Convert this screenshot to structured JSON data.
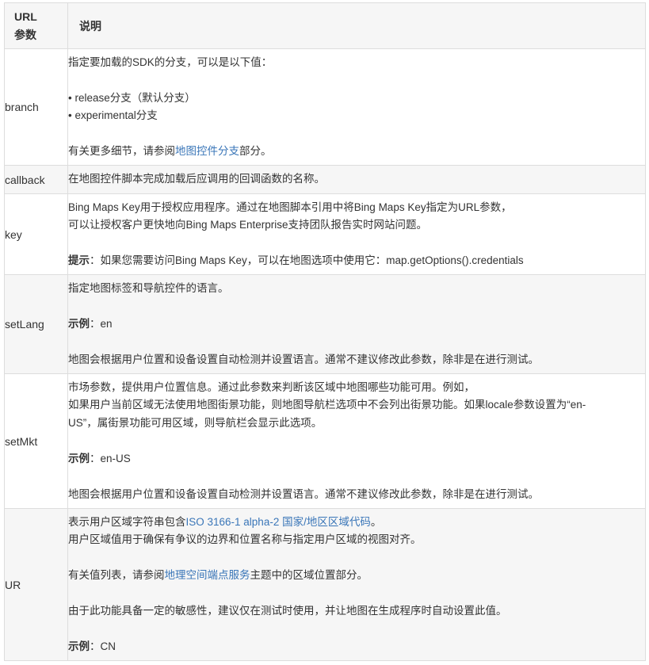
{
  "header": {
    "param_line1": "URL",
    "param_line2": "参数",
    "desc": "说明"
  },
  "rows": [
    {
      "name": "branch",
      "lines": {
        "l1": "指定要加载的SDK的分支，可以是以下值：",
        "l2": "• release分支（默认分支）",
        "l3": "• experimental分支",
        "l4_pre": "有关更多细节，请参阅",
        "l4_link": "地图控件分支",
        "l4_post": "部分。"
      }
    },
    {
      "name": "callback",
      "lines": {
        "l1": "在地图控件脚本完成加载后应调用的回调函数的名称。"
      }
    },
    {
      "name": "key",
      "lines": {
        "l1": "Bing Maps Key用于授权应用程序。通过在地图脚本引用中将Bing Maps Key指定为URL参数，",
        "l2": "可以让授权客户更快地向Bing Maps Enterprise支持团队报告实时网站问题。",
        "l3_label": "提示",
        "l3_text": "：如果您需要访问Bing Maps Key，可以在地图选项中使用它：map.getOptions().credentials"
      }
    },
    {
      "name": "setLang",
      "lines": {
        "l1": "指定地图标签和导航控件的语言。",
        "l2_label": "示例",
        "l2_text": "：en",
        "l3": "地图会根据用户位置和设备设置自动检测并设置语言。通常不建议修改此参数，除非是在进行测试。"
      }
    },
    {
      "name": "setMkt",
      "lines": {
        "l1": "市场参数，提供用户位置信息。通过此参数来判断该区域中地图哪些功能可用。例如，",
        "l2": "如果用户当前区域无法使用地图街景功能，则地图导航栏选项中不会列出街景功能。如果locale参数设置为“en-",
        "l3": "US”，属街景功能可用区域，则导航栏会显示此选项。",
        "l4_label": "示例",
        "l4_text": "：en-US",
        "l5": "地图会根据用户位置和设备设置自动检测并设置语言。通常不建议修改此参数，除非是在进行测试。"
      }
    },
    {
      "name": "UR",
      "lines": {
        "l1_pre": "表示用户区域字符串包含",
        "l1_link": "ISO 3166-1 alpha-2 国家/地区区域代码",
        "l1_post": "。",
        "l2": "用户区域值用于确保有争议的边界和位置名称与指定用户区域的视图对齐。",
        "l3_pre": "有关值列表，请参阅",
        "l3_link": "地理空间端点服务",
        "l3_post": "主题中的区域位置部分。",
        "l4": "由于此功能具备一定的敏感性，建议仅在测试时使用，并让地图在生成程序时自动设置此值。",
        "l5_label": "示例",
        "l5_text": "：CN"
      }
    }
  ]
}
